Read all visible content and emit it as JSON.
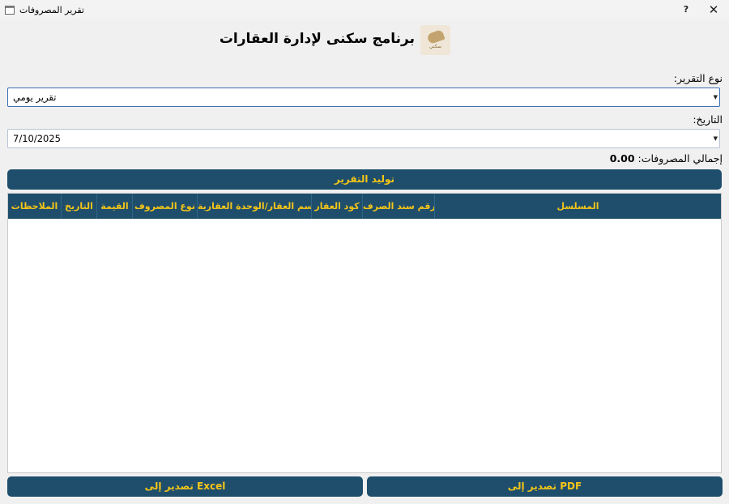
{
  "window": {
    "title": "تقرير المصروفات",
    "help_label": "?",
    "close_label": "✕"
  },
  "header": {
    "app_title": "برنامج سكنى لإدارة العقارات",
    "logo_text": "سكني"
  },
  "form": {
    "report_type_label": "نوع التقرير:",
    "report_type_value": "تقرير يومي",
    "date_label": "التاريخ:",
    "date_value": "7/10/2025",
    "total_label": "إجمالي المصروفات:",
    "total_value": "0.00"
  },
  "buttons": {
    "generate": "توليد التقرير",
    "export_excel": "تصدير إلى Excel",
    "export_pdf": "تصدير إلى PDF"
  },
  "table": {
    "columns": [
      "المسلسل",
      "رقم سند الصرف",
      "كود العقار",
      "اسم العقار/الوحدة العقارية",
      "نوع المصروف",
      "القيمة",
      "التاريخ",
      "الملاحظات"
    ],
    "rows": []
  },
  "colors": {
    "accent": "#1e4e6c",
    "header_text": "#f5c518",
    "focus_border": "#3c6fb6"
  },
  "icons": {
    "window": "window-app-icon",
    "logo": "sakani-logo-icon",
    "dropdown": "dropdown-arrow-icon"
  }
}
